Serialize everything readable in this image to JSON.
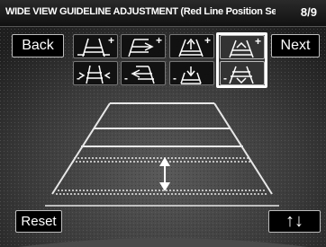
{
  "header": {
    "title": "WIDE VIEW GUIDELINE ADJUSTMENT (Red Line Position Setting)",
    "page": "8/9"
  },
  "buttons": {
    "back": "Back",
    "next": "Next",
    "reset": "Reset",
    "updown": "↑↓"
  },
  "adjust_icons": [
    {
      "name": "width-increase-icon",
      "sign": "+"
    },
    {
      "name": "angle-increase-icon",
      "sign": "+"
    },
    {
      "name": "length-increase-icon",
      "sign": "+"
    },
    {
      "name": "red-line-position-up-icon",
      "sign": "+"
    },
    {
      "name": "width-decrease-icon",
      "sign": "-"
    },
    {
      "name": "angle-decrease-icon",
      "sign": "-"
    },
    {
      "name": "length-decrease-icon",
      "sign": "-"
    },
    {
      "name": "red-line-position-down-icon",
      "sign": "-"
    }
  ],
  "colors": {
    "guide_lines": "#e8e8e8",
    "highlight_border": "#ffffff",
    "button_border": "#bdbdbd"
  }
}
